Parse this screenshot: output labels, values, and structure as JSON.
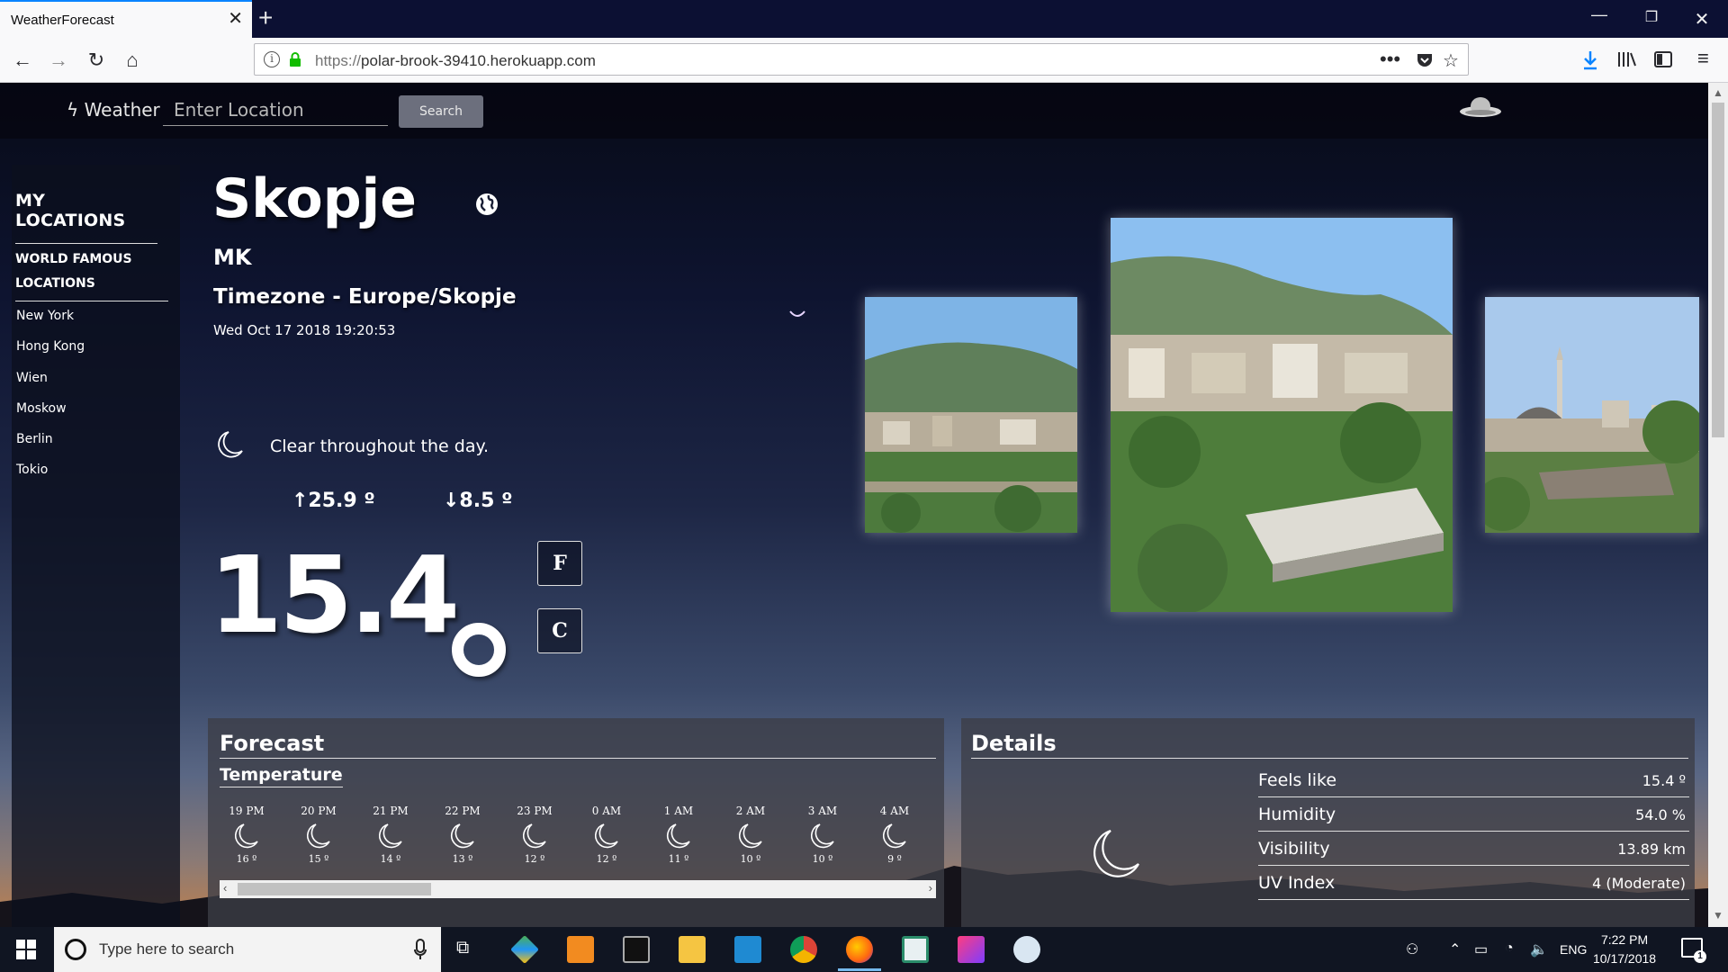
{
  "browser": {
    "tab_title": "WeatherForecast",
    "url_host": "polar-brook-39410.herokuapp.com",
    "url_scheme": "https://"
  },
  "app": {
    "brand": "Weather",
    "search_placeholder": "Enter Location",
    "search_button": "Search"
  },
  "sidebar": {
    "heading": "MY LOCATIONS",
    "subheading_line1": "WORLD FAMOUS",
    "subheading_line2": "LOCATIONS",
    "items": [
      "New York",
      "Hong Kong",
      "Wien",
      "Moskow",
      "Berlin",
      "Tokio"
    ]
  },
  "location": {
    "city": "Skopje",
    "country": "MK",
    "timezone": "Timezone - Europe/Skopje",
    "datetime": "Wed Oct 17 2018 19:20:53"
  },
  "current": {
    "summary": "Clear throughout the day.",
    "high": "↑25.9 º",
    "low": "↓8.5 º",
    "temperature": "15.4",
    "unit_f": "F",
    "unit_c": "C"
  },
  "forecast": {
    "title": "Forecast",
    "subtitle": "Temperature",
    "hours": [
      {
        "label": "19 PM",
        "temp": "16 º"
      },
      {
        "label": "20 PM",
        "temp": "15 º"
      },
      {
        "label": "21 PM",
        "temp": "14 º"
      },
      {
        "label": "22 PM",
        "temp": "13 º"
      },
      {
        "label": "23 PM",
        "temp": "12 º"
      },
      {
        "label": "0 AM",
        "temp": "12 º"
      },
      {
        "label": "1 AM",
        "temp": "11 º"
      },
      {
        "label": "2 AM",
        "temp": "10 º"
      },
      {
        "label": "3 AM",
        "temp": "10 º"
      },
      {
        "label": "4 AM",
        "temp": "9 º"
      }
    ]
  },
  "details": {
    "title": "Details",
    "rows": [
      {
        "label": "Feels like",
        "value": "15.4 º"
      },
      {
        "label": "Humidity",
        "value": "54.0 %"
      },
      {
        "label": "Visibility",
        "value": "13.89 km"
      },
      {
        "label": "UV Index",
        "value": "4 (Moderate)"
      }
    ]
  },
  "taskbar": {
    "search_placeholder": "Type here to search",
    "language": "ENG",
    "time": "7:22 PM",
    "date": "10/17/2018",
    "notifications": "1"
  },
  "colors": {
    "browser_accent": "#0a84ff",
    "search_button_bg": "#6c6f7d",
    "panel_bg": "#3c3e46"
  }
}
